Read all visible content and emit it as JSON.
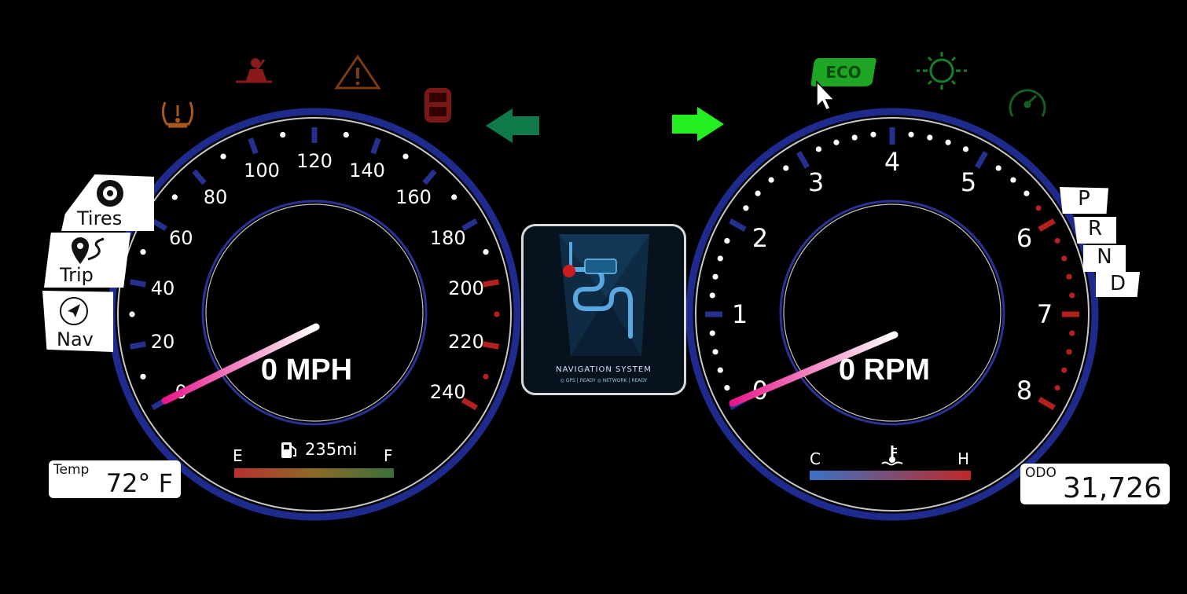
{
  "speedometer": {
    "readout": "0 MPH",
    "tick_labels": [
      "0",
      "20",
      "40",
      "60",
      "80",
      "100",
      "120",
      "140",
      "160",
      "180",
      "200",
      "220",
      "240"
    ],
    "fuel": {
      "empty_label": "E",
      "full_label": "F",
      "range_text": "235mi",
      "icon": "fuel-pump-icon"
    },
    "speed_value": 0
  },
  "tachometer": {
    "readout": "0 RPM",
    "tick_labels": [
      "0",
      "1",
      "2",
      "3",
      "4",
      "5",
      "6",
      "7",
      "8"
    ],
    "temp": {
      "cold_label": "C",
      "hot_label": "H",
      "icon": "coolant-temp-icon"
    },
    "rpm_value": 0
  },
  "left_menu": {
    "items": [
      {
        "label": "Tires",
        "icon": "tire-icon"
      },
      {
        "label": "Trip",
        "icon": "route-pin-icon"
      },
      {
        "label": "Nav",
        "icon": "compass-icon"
      }
    ]
  },
  "temp_box": {
    "label": "Temp",
    "value": "72° F"
  },
  "odo_box": {
    "label": "ODO",
    "value": "31,726"
  },
  "gears": [
    "P",
    "R",
    "N",
    "D"
  ],
  "warning_lights": [
    {
      "name": "tire-pressure-warning-icon",
      "color": "#a8581a"
    },
    {
      "name": "seatbelt-warning-icon",
      "color": "#8a1a1a"
    },
    {
      "name": "hazard-warning-icon",
      "color": "#7a3a16"
    },
    {
      "name": "door-ajar-icon",
      "color": "#7a1818"
    }
  ],
  "indicator_lights": [
    {
      "name": "eco-icon",
      "label": "ECO",
      "color": "#1fa524"
    },
    {
      "name": "headlight-icon",
      "color": "#1a7f2a"
    },
    {
      "name": "cruise-control-icon",
      "color": "#145e22"
    }
  ],
  "turn_signals": {
    "left_color": "#117a4a",
    "right_color": "#22ee22"
  },
  "nav_card": {
    "title": "NAVIGATION SYSTEM",
    "status": "◎ GPS | READY    ◎ NETWORK | READY"
  },
  "colors": {
    "dial_ring": "#1e2a8c",
    "dial_inner": "#2a3296",
    "redline": "#b52020"
  }
}
